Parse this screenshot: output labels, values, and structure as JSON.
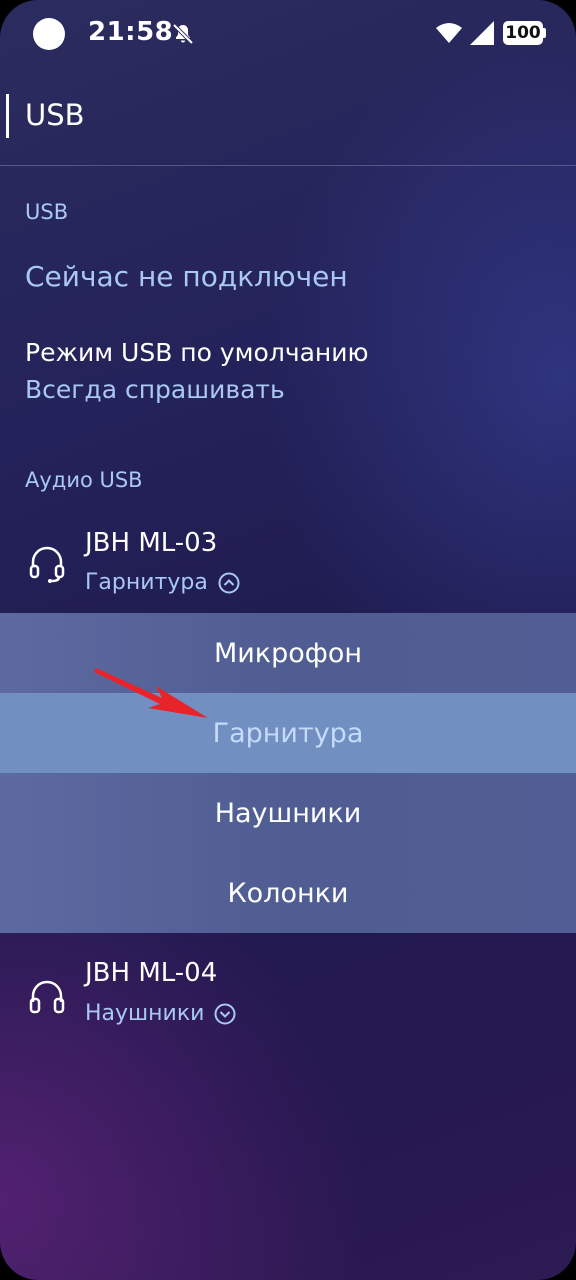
{
  "status_bar": {
    "time": "21:58",
    "battery": "100",
    "icons": [
      "camera-dot-icon",
      "bell-off-icon",
      "wifi-icon",
      "signal-icon",
      "battery-icon"
    ]
  },
  "header": {
    "title": "USB"
  },
  "usb_section": {
    "label": "USB",
    "connection_status": "Сейчас не подключен",
    "default_mode_title": "Режим USB по умолчанию",
    "default_mode_value": "Всегда спрашивать"
  },
  "audio_section": {
    "label": "Аудио USB",
    "devices": [
      {
        "name": "JBH ML-03",
        "type": "Гарнитура",
        "icon": "headset-icon",
        "expanded": true
      },
      {
        "name": "JBH ML-04",
        "type": "Наушники",
        "icon": "headphones-icon",
        "expanded": false
      }
    ]
  },
  "dropdown": {
    "options": [
      "Микрофон",
      "Гарнитура",
      "Наушники",
      "Колонки"
    ],
    "selected": "Гарнитура"
  },
  "colors": {
    "accent_text": "#a9c8f4",
    "dropdown_bg": "#4f5d92",
    "dropdown_selected_bg": "#718fc0",
    "arrow": "#e8232a"
  }
}
